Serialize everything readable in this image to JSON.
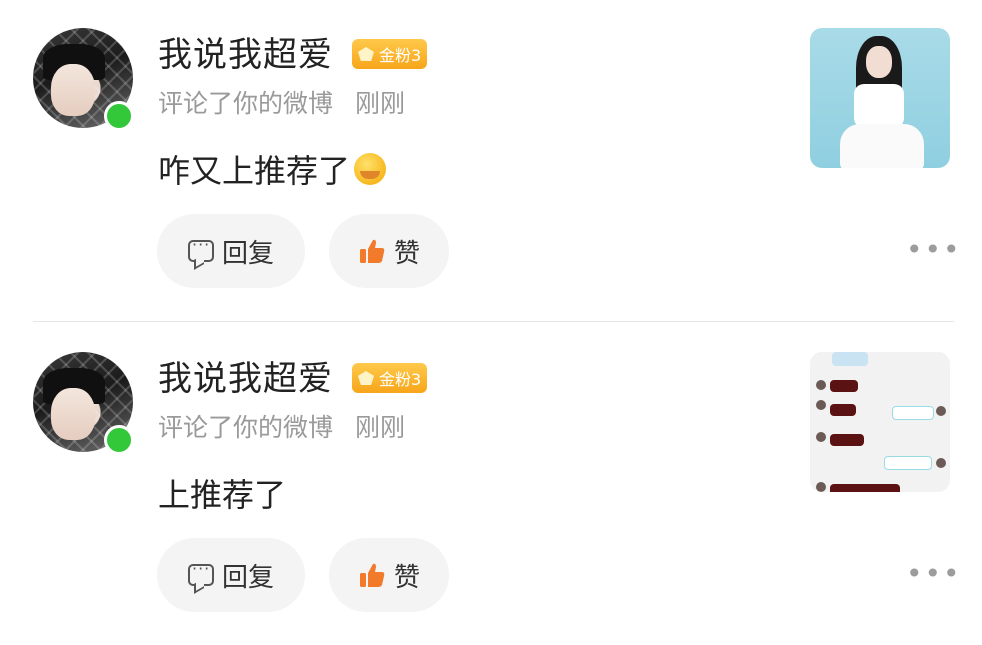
{
  "colors": {
    "online": "#32c83a",
    "badge": "#f7a51a",
    "like": "#f27a2b",
    "meta": "#9a9a9a"
  },
  "notifications": [
    {
      "username": "我说我超爱",
      "badge": "金粉3",
      "action": "评论了你的微博",
      "time": "刚刚",
      "comment": "咋又上推荐了",
      "emoji": "hehe-emoji",
      "reply_label": "回复",
      "like_label": "赞",
      "thumbnail": "photo"
    },
    {
      "username": "我说我超爱",
      "badge": "金粉3",
      "action": "评论了你的微博",
      "time": "刚刚",
      "comment": "上推荐了",
      "reply_label": "回复",
      "like_label": "赞",
      "thumbnail": "chat-screenshot"
    }
  ]
}
